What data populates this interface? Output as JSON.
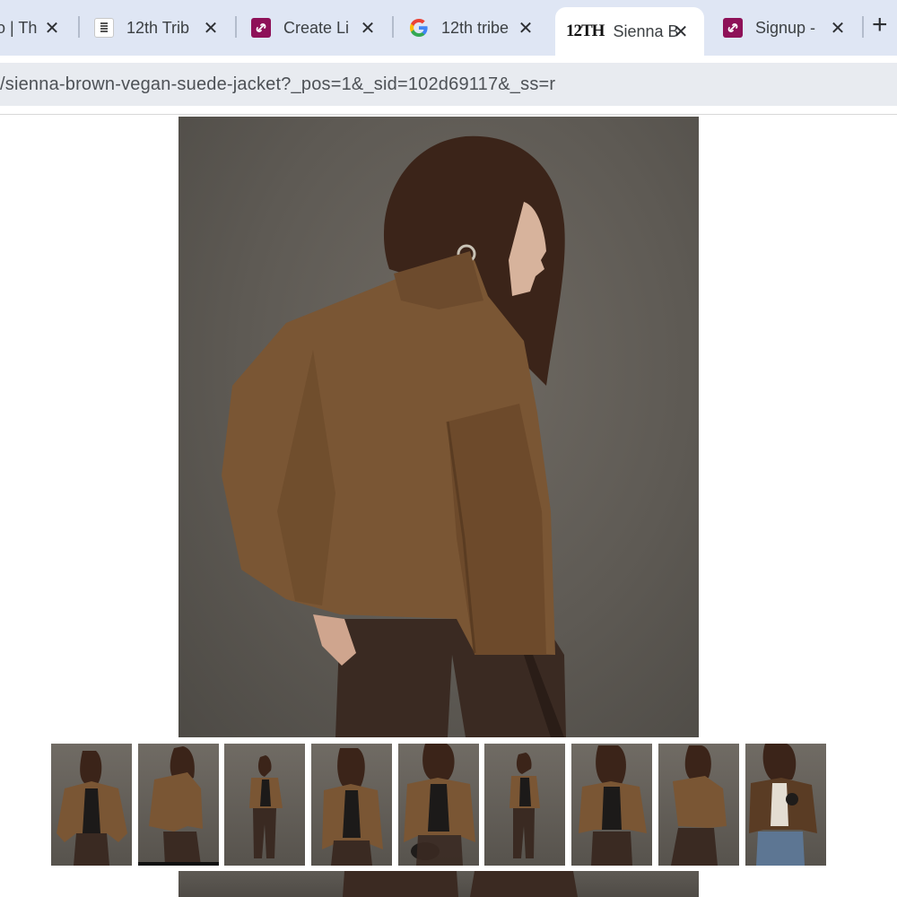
{
  "browser": {
    "tabs": [
      {
        "title": "o | Th",
        "favicon": "partial-tab"
      },
      {
        "title": "12th Trib",
        "favicon": "12th-tribe-icon"
      },
      {
        "title": "Create Li",
        "favicon": "purple-link-icon"
      },
      {
        "title": "12th tribe",
        "favicon": "google-icon"
      },
      {
        "title": "Sienna B",
        "favicon": "12th-tribe-logo-icon",
        "favicon_text": "12TH",
        "active": true
      },
      {
        "title": "Signup -",
        "favicon": "purple-link-icon"
      }
    ],
    "close_glyph": "✕",
    "new_tab_glyph": "+",
    "url": "/sienna-brown-vegan-suede-jacket?_pos=1&_sid=102d69117&_ss=r"
  },
  "product": {
    "main_image": "model-back-view-brown-suede-jacket",
    "thumbnails": [
      {
        "name": "front-view-open-jacket",
        "selected": false
      },
      {
        "name": "back-view",
        "selected": true
      },
      {
        "name": "full-length-front",
        "selected": false
      },
      {
        "name": "front-view-hands-low",
        "selected": false
      },
      {
        "name": "front-view-with-bag",
        "selected": false
      },
      {
        "name": "full-length-side",
        "selected": false
      },
      {
        "name": "front-view-hands-pockets",
        "selected": false
      },
      {
        "name": "side-view-turned",
        "selected": false
      },
      {
        "name": "jeans-styling-with-bag",
        "selected": false
      }
    ]
  },
  "colors": {
    "jacket": "#7a5634",
    "jacket_shadow": "#5e3f23",
    "hair": "#3b2419",
    "pants": "#3a2a22",
    "backdrop": "#615d57",
    "skin": "#d7b39c",
    "tab_strip": "#dfe6f4",
    "omnibox": "#e8ebf0",
    "favicon_purple": "#8e1158"
  }
}
